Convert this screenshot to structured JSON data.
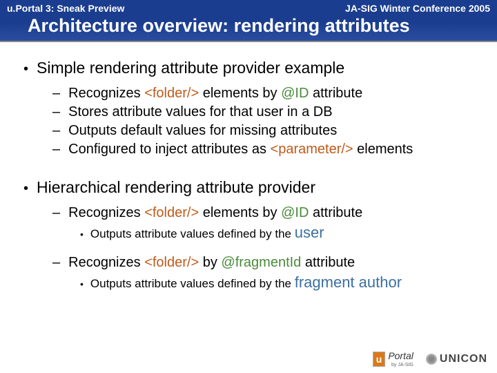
{
  "header": {
    "left": "u.Portal 3: Sneak Preview",
    "right": "JA-SIG Winter Conference 2005",
    "title": "Architecture overview: rendering attributes"
  },
  "section1": {
    "title": "Simple rendering attribute provider example",
    "items": {
      "i0": {
        "pre": "Recognizes ",
        "tag": "<folder/>",
        "mid": " elements by ",
        "attr": "@ID",
        "post": " attribute"
      },
      "i1": {
        "text": "Stores attribute values for that user in a DB"
      },
      "i2": {
        "text": "Outputs default values for missing attributes"
      },
      "i3": {
        "pre": "Configured to inject attributes as ",
        "tag": "<parameter/>",
        "post": " elements"
      }
    }
  },
  "section2": {
    "title": "Hierarchical rendering attribute provider",
    "item0": {
      "pre": "Recognizes ",
      "tag": "<folder/>",
      "mid": " elements by ",
      "attr": "@ID",
      "post": " attribute"
    },
    "item0sub": {
      "pre": "Outputs attribute values defined by the ",
      "emph": "user"
    },
    "item1": {
      "pre": "Recognizes ",
      "tag": "<folder/>",
      "mid": " by ",
      "attr": "@fragmentId",
      "post": " attribute"
    },
    "item1sub": {
      "pre": "Outputs attribute values defined by the ",
      "emph": "fragment author"
    }
  },
  "footer": {
    "uportal_u": "u",
    "uportal_text": "Portal",
    "jasig": "by JA-SIG",
    "unicon": "UNICON"
  }
}
